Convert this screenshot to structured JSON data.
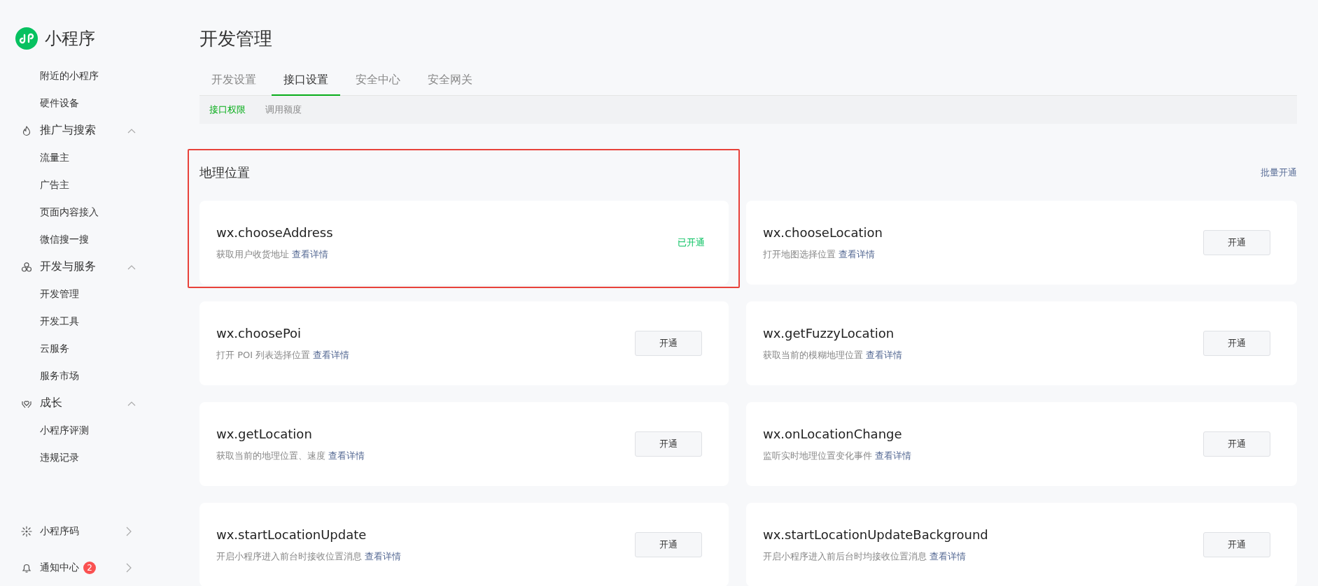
{
  "app": {
    "name": "小程序"
  },
  "sidebar": {
    "items": [
      {
        "label": "附近的小程序"
      },
      {
        "label": "硬件设备"
      }
    ],
    "groups": [
      {
        "label": "推广与搜索",
        "expanded": true,
        "children": [
          {
            "label": "流量主"
          },
          {
            "label": "广告主"
          },
          {
            "label": "页面内容接入"
          },
          {
            "label": "微信搜一搜"
          }
        ]
      },
      {
        "label": "开发与服务",
        "expanded": true,
        "children": [
          {
            "label": "开发管理"
          },
          {
            "label": "开发工具"
          },
          {
            "label": "云服务"
          },
          {
            "label": "服务市场"
          }
        ]
      },
      {
        "label": "成长",
        "expanded": true,
        "children": [
          {
            "label": "小程序评测"
          },
          {
            "label": "违规记录"
          }
        ]
      }
    ],
    "bottom": [
      {
        "label": "小程序码"
      },
      {
        "label": "通知中心",
        "badge": "2"
      }
    ]
  },
  "page": {
    "title": "开发管理"
  },
  "tabs": [
    {
      "label": "开发设置",
      "selected": false
    },
    {
      "label": "接口设置",
      "selected": true
    },
    {
      "label": "安全中心",
      "selected": false
    },
    {
      "label": "安全网关",
      "selected": false
    }
  ],
  "subtabs": [
    {
      "label": "接口权限",
      "selected": true
    },
    {
      "label": "调用额度",
      "selected": false
    }
  ],
  "section": {
    "title": "地理位置",
    "batch_link": "批量开通",
    "highlighted": true,
    "apis": [
      {
        "name": "wx.chooseAddress",
        "description": "获取用户收货地址",
        "link": "查看详情",
        "enabled": true,
        "action": "已开通"
      },
      {
        "name": "wx.chooseLocation",
        "description": "打开地图选择位置",
        "link": "查看详情",
        "enabled": false,
        "action": "开通"
      },
      {
        "name": "wx.choosePoi",
        "description": "打开 POI 列表选择位置",
        "link": "查看详情",
        "enabled": false,
        "action": "开通"
      },
      {
        "name": "wx.getFuzzyLocation",
        "description": "获取当前的模糊地理位置",
        "link": "查看详情",
        "enabled": false,
        "action": "开通"
      },
      {
        "name": "wx.getLocation",
        "description": "获取当前的地理位置、速度",
        "link": "查看详情",
        "enabled": false,
        "action": "开通"
      },
      {
        "name": "wx.onLocationChange",
        "description": "监听实时地理位置变化事件",
        "link": "查看详情",
        "enabled": false,
        "action": "开通"
      },
      {
        "name": "wx.startLocationUpdate",
        "description": "开启小程序进入前台时接收位置消息",
        "link": "查看详情",
        "enabled": false,
        "action": "开通"
      },
      {
        "name": "wx.startLocationUpdateBackground",
        "description": "开启小程序进入前后台时均接收位置消息",
        "link": "查看详情",
        "enabled": false,
        "action": "开通"
      }
    ]
  }
}
